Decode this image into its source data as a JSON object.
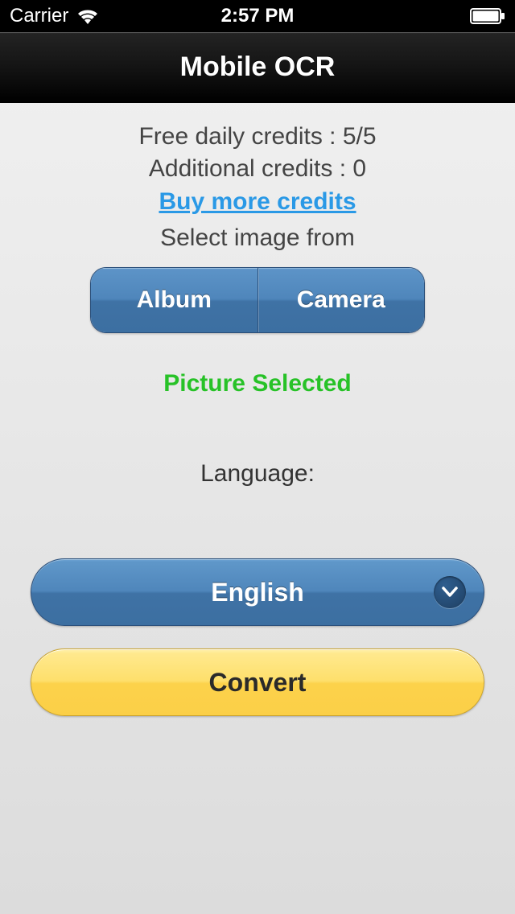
{
  "status_bar": {
    "carrier": "Carrier",
    "time": "2:57 PM"
  },
  "nav": {
    "title": "Mobile OCR"
  },
  "credits": {
    "free_line": "Free daily credits : 5/5",
    "additional_line": "Additional credits : 0",
    "buy_link": "Buy more credits"
  },
  "source": {
    "label": "Select image from",
    "album": "Album",
    "camera": "Camera"
  },
  "status_text": "Picture Selected",
  "language": {
    "label": "Language:",
    "selected": "English"
  },
  "convert_label": "Convert"
}
